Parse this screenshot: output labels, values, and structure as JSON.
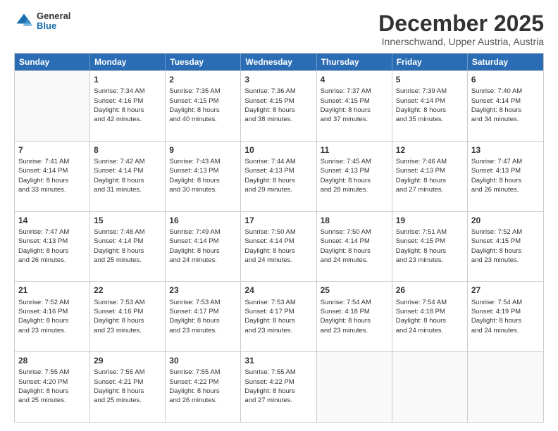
{
  "logo": {
    "general": "General",
    "blue": "Blue"
  },
  "title": "December 2025",
  "subtitle": "Innerschwand, Upper Austria, Austria",
  "header_days": [
    "Sunday",
    "Monday",
    "Tuesday",
    "Wednesday",
    "Thursday",
    "Friday",
    "Saturday"
  ],
  "weeks": [
    [
      {
        "day": "",
        "info": ""
      },
      {
        "day": "1",
        "info": "Sunrise: 7:34 AM\nSunset: 4:16 PM\nDaylight: 8 hours\nand 42 minutes."
      },
      {
        "day": "2",
        "info": "Sunrise: 7:35 AM\nSunset: 4:15 PM\nDaylight: 8 hours\nand 40 minutes."
      },
      {
        "day": "3",
        "info": "Sunrise: 7:36 AM\nSunset: 4:15 PM\nDaylight: 8 hours\nand 38 minutes."
      },
      {
        "day": "4",
        "info": "Sunrise: 7:37 AM\nSunset: 4:15 PM\nDaylight: 8 hours\nand 37 minutes."
      },
      {
        "day": "5",
        "info": "Sunrise: 7:39 AM\nSunset: 4:14 PM\nDaylight: 8 hours\nand 35 minutes."
      },
      {
        "day": "6",
        "info": "Sunrise: 7:40 AM\nSunset: 4:14 PM\nDaylight: 8 hours\nand 34 minutes."
      }
    ],
    [
      {
        "day": "7",
        "info": "Sunrise: 7:41 AM\nSunset: 4:14 PM\nDaylight: 8 hours\nand 33 minutes."
      },
      {
        "day": "8",
        "info": "Sunrise: 7:42 AM\nSunset: 4:14 PM\nDaylight: 8 hours\nand 31 minutes."
      },
      {
        "day": "9",
        "info": "Sunrise: 7:43 AM\nSunset: 4:13 PM\nDaylight: 8 hours\nand 30 minutes."
      },
      {
        "day": "10",
        "info": "Sunrise: 7:44 AM\nSunset: 4:13 PM\nDaylight: 8 hours\nand 29 minutes."
      },
      {
        "day": "11",
        "info": "Sunrise: 7:45 AM\nSunset: 4:13 PM\nDaylight: 8 hours\nand 28 minutes."
      },
      {
        "day": "12",
        "info": "Sunrise: 7:46 AM\nSunset: 4:13 PM\nDaylight: 8 hours\nand 27 minutes."
      },
      {
        "day": "13",
        "info": "Sunrise: 7:47 AM\nSunset: 4:13 PM\nDaylight: 8 hours\nand 26 minutes."
      }
    ],
    [
      {
        "day": "14",
        "info": "Sunrise: 7:47 AM\nSunset: 4:13 PM\nDaylight: 8 hours\nand 26 minutes."
      },
      {
        "day": "15",
        "info": "Sunrise: 7:48 AM\nSunset: 4:14 PM\nDaylight: 8 hours\nand 25 minutes."
      },
      {
        "day": "16",
        "info": "Sunrise: 7:49 AM\nSunset: 4:14 PM\nDaylight: 8 hours\nand 24 minutes."
      },
      {
        "day": "17",
        "info": "Sunrise: 7:50 AM\nSunset: 4:14 PM\nDaylight: 8 hours\nand 24 minutes."
      },
      {
        "day": "18",
        "info": "Sunrise: 7:50 AM\nSunset: 4:14 PM\nDaylight: 8 hours\nand 24 minutes."
      },
      {
        "day": "19",
        "info": "Sunrise: 7:51 AM\nSunset: 4:15 PM\nDaylight: 8 hours\nand 23 minutes."
      },
      {
        "day": "20",
        "info": "Sunrise: 7:52 AM\nSunset: 4:15 PM\nDaylight: 8 hours\nand 23 minutes."
      }
    ],
    [
      {
        "day": "21",
        "info": "Sunrise: 7:52 AM\nSunset: 4:16 PM\nDaylight: 8 hours\nand 23 minutes."
      },
      {
        "day": "22",
        "info": "Sunrise: 7:53 AM\nSunset: 4:16 PM\nDaylight: 8 hours\nand 23 minutes."
      },
      {
        "day": "23",
        "info": "Sunrise: 7:53 AM\nSunset: 4:17 PM\nDaylight: 8 hours\nand 23 minutes."
      },
      {
        "day": "24",
        "info": "Sunrise: 7:53 AM\nSunset: 4:17 PM\nDaylight: 8 hours\nand 23 minutes."
      },
      {
        "day": "25",
        "info": "Sunrise: 7:54 AM\nSunset: 4:18 PM\nDaylight: 8 hours\nand 23 minutes."
      },
      {
        "day": "26",
        "info": "Sunrise: 7:54 AM\nSunset: 4:18 PM\nDaylight: 8 hours\nand 24 minutes."
      },
      {
        "day": "27",
        "info": "Sunrise: 7:54 AM\nSunset: 4:19 PM\nDaylight: 8 hours\nand 24 minutes."
      }
    ],
    [
      {
        "day": "28",
        "info": "Sunrise: 7:55 AM\nSunset: 4:20 PM\nDaylight: 8 hours\nand 25 minutes."
      },
      {
        "day": "29",
        "info": "Sunrise: 7:55 AM\nSunset: 4:21 PM\nDaylight: 8 hours\nand 25 minutes."
      },
      {
        "day": "30",
        "info": "Sunrise: 7:55 AM\nSunset: 4:22 PM\nDaylight: 8 hours\nand 26 minutes."
      },
      {
        "day": "31",
        "info": "Sunrise: 7:55 AM\nSunset: 4:22 PM\nDaylight: 8 hours\nand 27 minutes."
      },
      {
        "day": "",
        "info": ""
      },
      {
        "day": "",
        "info": ""
      },
      {
        "day": "",
        "info": ""
      }
    ]
  ]
}
